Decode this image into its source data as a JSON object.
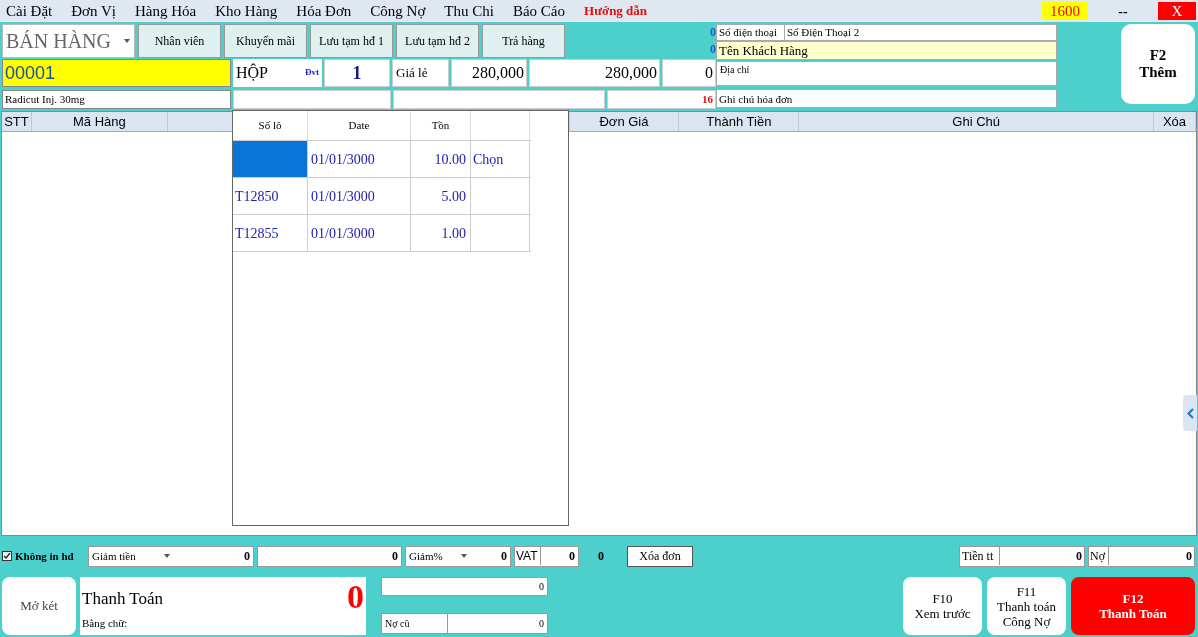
{
  "menu": [
    {
      "label": "Cài Đặt",
      "kind": "normal"
    },
    {
      "label": "Đơn Vị",
      "kind": "normal"
    },
    {
      "label": "Hàng Hóa",
      "kind": "normal"
    },
    {
      "label": "Kho Hàng",
      "kind": "normal"
    },
    {
      "label": "Hóa Đơn",
      "kind": "normal"
    },
    {
      "label": "Công Nợ",
      "kind": "normal"
    },
    {
      "label": "Thu Chi",
      "kind": "normal"
    },
    {
      "label": "Báo Cáo",
      "kind": "normal"
    },
    {
      "label": "Hướng dẫn",
      "kind": "highlight"
    }
  ],
  "window_controls": {
    "counter": "1600",
    "minimize": "--",
    "close": "X"
  },
  "toolbar": {
    "mode": "BÁN HÀNG",
    "buttons": [
      "Nhân viên",
      "Khuyến mãi",
      "Lưu tạm hđ 1",
      "Lưu tạm hđ 2",
      "Trả hàng"
    ],
    "counters": [
      "0",
      "0"
    ]
  },
  "customer": {
    "phone_label": "Số điện thoại",
    "phone2_placeholder": "Số Điện Thoại 2",
    "name_placeholder": "Tên Khách Hàng",
    "address_placeholder": "Địa chỉ",
    "note_placeholder": "Ghi chú hóa đơn",
    "note_count": "16"
  },
  "entry": {
    "code": "00001",
    "unit": "HỘP",
    "unit_label": "Đvt",
    "quantity": "1",
    "price_label": "Giá lẻ",
    "price": "280,000",
    "amount": "280,000",
    "discount": "0",
    "product_name": "Radicut Inj. 30mg"
  },
  "add_button": {
    "key": "F2",
    "label": "Thêm"
  },
  "table": {
    "columns": [
      "STT",
      "Mã Hàng",
      "Đơn Giá",
      "Thành Tiền",
      "Ghi Chú",
      "Xóa"
    ]
  },
  "lot_popup": {
    "columns": [
      "Số lô",
      "Date",
      "Tồn"
    ],
    "rows": [
      {
        "date": "01/01/3000",
        "stock": "10.00",
        "action": "Chọn",
        "selected": true
      },
      {
        "lot": "T12850",
        "date": "01/01/3000",
        "stock": "5.00",
        "selected": false
      },
      {
        "lot": "T12855",
        "date": "01/01/3000",
        "stock": "1.00",
        "selected": false
      }
    ]
  },
  "footer": {
    "no_print": {
      "label": "Không in hđ",
      "checked": true
    },
    "discount_amount": {
      "label": "Giảm tiền",
      "value": "0"
    },
    "discount_extra": "0",
    "discount_percent": {
      "label": "Giảm%",
      "value": "0"
    },
    "vat": {
      "label": "VAT",
      "value": "0"
    },
    "vat_total": "0",
    "clear_button": "Xóa đơn",
    "paid": {
      "label": "Tiền tt",
      "value": "0"
    },
    "debt": {
      "label": "Nợ",
      "value": "0"
    }
  },
  "payment": {
    "drawer_button": "Mở két",
    "title": "Thanh Toán",
    "total": "0",
    "in_words_label": "Bằng chữ:",
    "received": "0",
    "old_debt": {
      "label": "Nợ cũ",
      "value": "0"
    }
  },
  "actions": [
    {
      "key": "F10",
      "lines": [
        "Xem trước"
      ],
      "kind": "normal"
    },
    {
      "key": "F11",
      "lines": [
        "Thanh toán",
        "Công Nợ"
      ],
      "kind": "normal"
    },
    {
      "key": "F12",
      "lines": [
        "Thanh Toán"
      ],
      "kind": "primary"
    }
  ]
}
